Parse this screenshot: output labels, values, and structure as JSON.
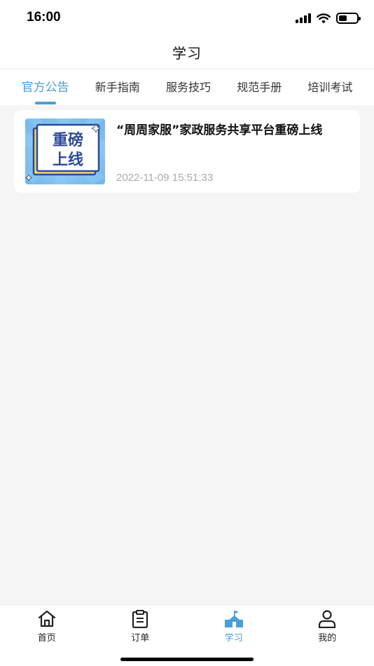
{
  "status_bar": {
    "time": "16:00",
    "battery_level": 0.45
  },
  "header": {
    "title": "学习"
  },
  "tabs": [
    {
      "label": "官方公告",
      "active": true
    },
    {
      "label": "新手指南",
      "active": false
    },
    {
      "label": "服务技巧",
      "active": false
    },
    {
      "label": "规范手册",
      "active": false
    },
    {
      "label": "培训考试",
      "active": false
    }
  ],
  "announcements": [
    {
      "title": "“周周家服”家政服务共享平台重磅上线",
      "date": "2022-11-09 15:51:33",
      "thumbnail_text_line1": "重磅",
      "thumbnail_text_line2": "上线"
    }
  ],
  "bottom_nav": [
    {
      "label": "首页",
      "icon": "home-icon",
      "active": false
    },
    {
      "label": "订单",
      "icon": "clipboard-icon",
      "active": false
    },
    {
      "label": "学习",
      "icon": "school-icon",
      "active": true
    },
    {
      "label": "我的",
      "icon": "user-icon",
      "active": false
    }
  ],
  "colors": {
    "accent": "#4a9fd8",
    "background": "#f5f5f5",
    "thumbnail_blue": "#3a55a8"
  }
}
